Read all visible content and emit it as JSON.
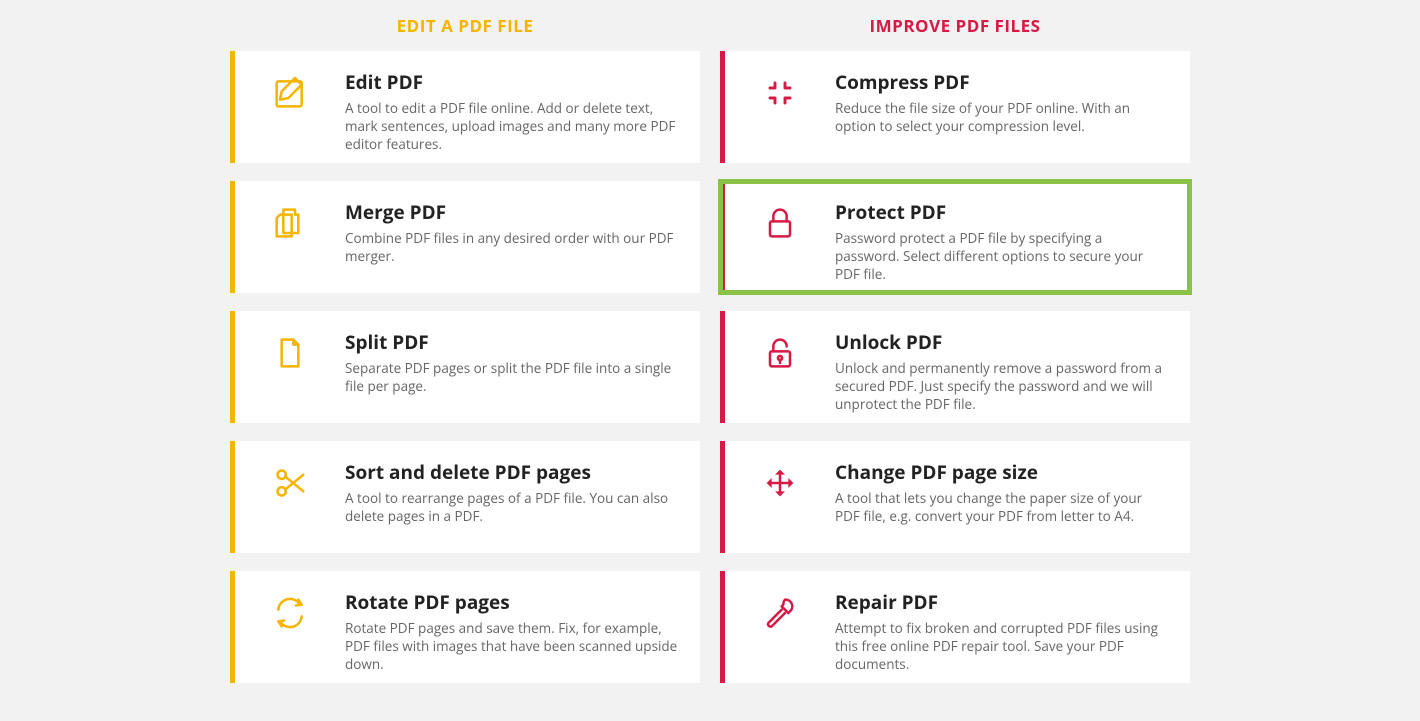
{
  "columns": {
    "left": {
      "heading": "EDIT A PDF FILE",
      "color": "#f5b400",
      "items": [
        {
          "icon": "edit-icon",
          "title": "Edit PDF",
          "desc": "A tool to edit a PDF file online. Add or delete text, mark sentences, upload images and many more PDF editor features."
        },
        {
          "icon": "merge-icon",
          "title": "Merge PDF",
          "desc": "Combine PDF files in any desired order with our PDF merger."
        },
        {
          "icon": "split-icon",
          "title": "Split PDF",
          "desc": "Separate PDF pages or split the PDF file into a single file per page."
        },
        {
          "icon": "sort-icon",
          "title": "Sort and delete PDF pages",
          "desc": "A tool to rearrange pages of a PDF file. You can also delete pages in a PDF."
        },
        {
          "icon": "rotate-icon",
          "title": "Rotate PDF pages",
          "desc": "Rotate PDF pages and save them. Fix, for example, PDF files with images that have been scanned upside down."
        }
      ]
    },
    "right": {
      "heading": "IMPROVE PDF FILES",
      "color": "#d61a46",
      "items": [
        {
          "icon": "compress-icon",
          "title": "Compress PDF",
          "desc": "Reduce the file size of your PDF online. With an option to select your compression level."
        },
        {
          "icon": "protect-icon",
          "title": "Protect PDF",
          "desc": "Password protect a PDF file by specifying a password. Select different options to secure your PDF file.",
          "highlight": true
        },
        {
          "icon": "unlock-icon",
          "title": "Unlock PDF",
          "desc": "Unlock and permanently remove a password from a secured PDF. Just specify the password and we will unprotect the PDF file."
        },
        {
          "icon": "resize-icon",
          "title": "Change PDF page size",
          "desc": "A tool that lets you change the paper size of your PDF file, e.g. convert your PDF from letter to A4."
        },
        {
          "icon": "repair-icon",
          "title": "Repair PDF",
          "desc": "Attempt to fix broken and corrupted PDF files using this free online PDF repair tool. Save your PDF documents."
        }
      ]
    }
  }
}
